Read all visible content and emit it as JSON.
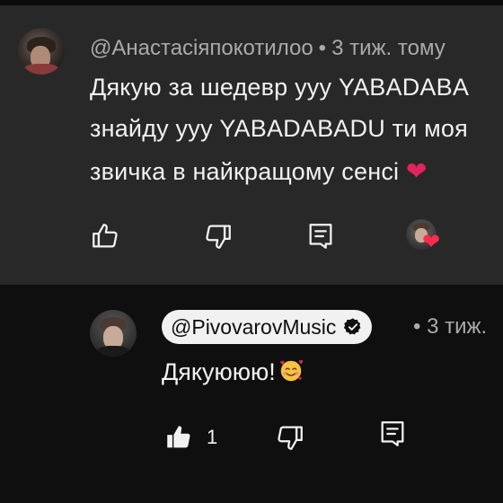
{
  "comment": {
    "author": "@Анастасіяпокотилоо",
    "separator": "•",
    "time": "3 тиж. тому",
    "lines": [
      "Дякую за шедевр ууу YABADABA",
      "знайду ууу YABADABADU ти моя",
      "звичка в найкращому сенсі"
    ],
    "heart_emoji": "❤",
    "actions": [
      "like-icon",
      "dislike-icon",
      "reply-icon"
    ],
    "creator_heart": "❤"
  },
  "reply": {
    "author": "@PivovarovMusic",
    "separator": "•",
    "time": "3 тиж.",
    "text": "Дякуююю!",
    "emoji": "smiling-face-with-hearts",
    "like_count": "1",
    "actions": [
      "like-icon-filled",
      "dislike-icon",
      "reply-icon"
    ]
  },
  "colors": {
    "comment_bg": "#282828",
    "reply_bg": "#0f0f0f",
    "meta_text": "#aaaaaa",
    "text": "#f1f1f1",
    "heart": "#e0245e"
  }
}
